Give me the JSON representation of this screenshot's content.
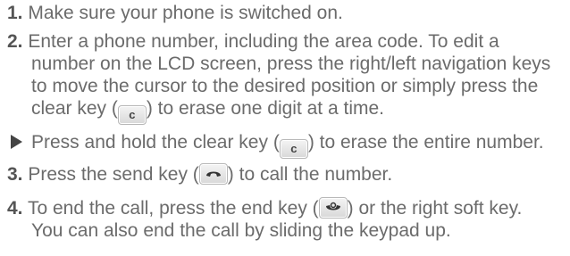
{
  "step1": {
    "num": "1.",
    "text": "Make sure your phone is switched on."
  },
  "step2": {
    "num": "2.",
    "line1": "Enter a phone number, including the area code. To edit a",
    "line2": "number on the LCD screen, press the right/left navigation keys",
    "line3": "to move the cursor to the desired position or simply press the",
    "line4_before": "clear key (",
    "line4_key": "c",
    "line4_after": ") to erase one digit at a time."
  },
  "tip": {
    "before": "Press and hold the clear key (",
    "key": "c",
    "after": ") to erase the entire number."
  },
  "step3": {
    "num": "3.",
    "before": "Press the send key (",
    "after": ") to call the number."
  },
  "step4": {
    "num": "4.",
    "line1_before": "To end the call, press the end key (",
    "line1_after": ") or the right soft key.",
    "line2": "You can also end the call by sliding the keypad up."
  },
  "icons": {
    "clear": "clear-key-icon",
    "send": "send-key-icon",
    "end": "end-key-icon",
    "tip": "play-arrow-icon"
  }
}
